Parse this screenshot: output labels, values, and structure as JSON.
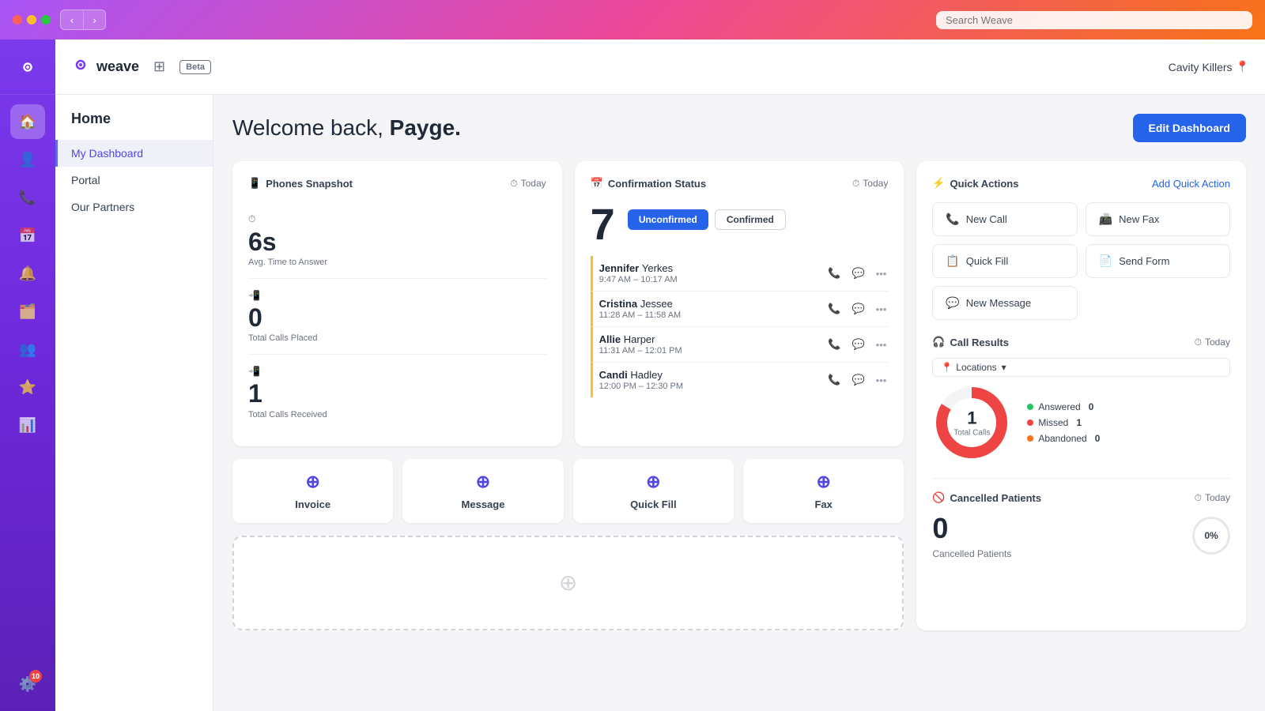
{
  "browser": {
    "search_placeholder": "Search Weave"
  },
  "app": {
    "logo_text": "weave",
    "beta_label": "Beta",
    "grid_icon": "⊞"
  },
  "topnav": {
    "location": "Cavity Killers"
  },
  "sidebar": {
    "title": "Home",
    "items": [
      {
        "label": "My Dashboard",
        "active": true
      },
      {
        "label": "Portal",
        "active": false
      },
      {
        "label": "Our Partners",
        "active": false
      }
    ]
  },
  "header": {
    "welcome": "Welcome back, ",
    "username": "Payge.",
    "edit_btn": "Edit Dashboard"
  },
  "phones_snapshot": {
    "title": "Phones Snapshot",
    "date": "Today",
    "avg_time": "6s",
    "avg_time_label": "Avg. Time to Answer",
    "total_placed": "0",
    "total_placed_label": "Total Calls Placed",
    "total_received": "1",
    "total_received_label": "Total Calls Received"
  },
  "confirmation_status": {
    "title": "Confirmation Status",
    "date": "Today",
    "count": "7",
    "tab_unconfirmed": "Unconfirmed",
    "tab_confirmed": "Confirmed",
    "patients": [
      {
        "first": "Jennifer",
        "last": "Yerkes",
        "time": "9:47 AM – 10:17 AM"
      },
      {
        "first": "Cristina",
        "last": "Jessee",
        "time": "11:28 AM – 11:58 AM"
      },
      {
        "first": "Allie",
        "last": "Harper",
        "time": "11:31 AM – 12:01 PM"
      },
      {
        "first": "Candi",
        "last": "Hadley",
        "time": "12:00 PM – 12:30 PM"
      }
    ]
  },
  "quick_actions": {
    "title": "Quick Actions",
    "add_label": "Add Quick Action",
    "buttons": [
      {
        "label": "New Call",
        "icon": "📞"
      },
      {
        "label": "New Fax",
        "icon": "📠"
      },
      {
        "label": "Quick Fill",
        "icon": "📋"
      },
      {
        "label": "Send Form",
        "icon": "📄"
      },
      {
        "label": "New Message",
        "icon": "💬"
      }
    ]
  },
  "call_results": {
    "title": "Call Results",
    "date": "Today",
    "locations_label": "Locations",
    "total_calls": "1",
    "total_calls_label": "Total Calls",
    "legend": [
      {
        "label": "Answered",
        "count": "0",
        "color": "#22c55e"
      },
      {
        "label": "Missed",
        "count": "1",
        "color": "#ef4444"
      },
      {
        "label": "Abandoned",
        "count": "0",
        "color": "#f97316"
      }
    ]
  },
  "shortcuts": [
    {
      "label": "Invoice",
      "icon": "⊕"
    },
    {
      "label": "Message",
      "icon": "⊕"
    },
    {
      "label": "Quick Fill",
      "icon": "⊕"
    },
    {
      "label": "Fax",
      "icon": "⊕"
    }
  ],
  "cancelled_patients": {
    "title": "Cancelled Patients",
    "date": "Today",
    "count": "0",
    "label": "Cancelled Patients",
    "percent": "0%"
  },
  "icon_nav": [
    {
      "icon": "🏠",
      "name": "home",
      "active": true
    },
    {
      "icon": "👤",
      "name": "contacts",
      "active": false
    },
    {
      "icon": "📞",
      "name": "phone",
      "active": false
    },
    {
      "icon": "📅",
      "name": "calendar",
      "active": false
    },
    {
      "icon": "🔔",
      "name": "notifications",
      "active": false
    },
    {
      "icon": "🗂️",
      "name": "records",
      "active": false
    },
    {
      "icon": "👥",
      "name": "team",
      "active": false
    },
    {
      "icon": "⭐",
      "name": "reviews",
      "active": false
    },
    {
      "icon": "📊",
      "name": "analytics",
      "active": false
    },
    {
      "icon": "⚙️",
      "name": "settings",
      "active": false
    }
  ],
  "bottom_badge_count": "10"
}
